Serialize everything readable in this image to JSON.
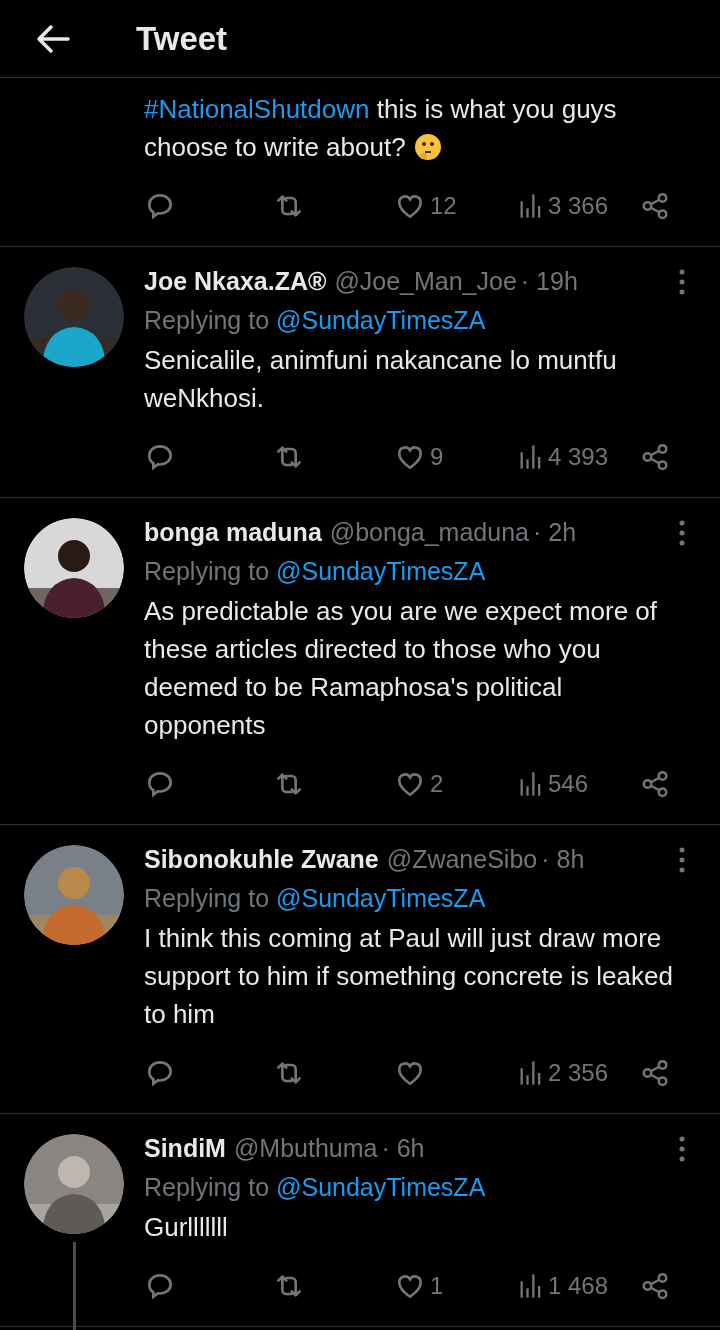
{
  "header": {
    "title": "Tweet"
  },
  "tweets": [
    {
      "body": [
        {
          "kind": "hashtag",
          "text": "#NationalShutdown"
        },
        {
          "kind": "text",
          "text": " this is what you guys choose to write about?"
        },
        {
          "kind": "emoji"
        }
      ],
      "likes": "12",
      "views": "3 366"
    },
    {
      "name": "Joe Nkaxa.ZA®",
      "handle": "@Joe_Man_Joe",
      "time": "· 19h",
      "replying_label": "Replying to",
      "replying_to": "@SundayTimesZA",
      "body": [
        {
          "kind": "text",
          "text": "Senicalile, animfuni nakancane lo muntfu weNkhosi."
        }
      ],
      "likes": "9",
      "views": "4 393"
    },
    {
      "name": "bonga maduna",
      "handle": "@bonga_maduna",
      "time": "· 2h",
      "replying_label": "Replying to",
      "replying_to": "@SundayTimesZA",
      "body": [
        {
          "kind": "text",
          "text": "As predictable as you are we expect more of these articles directed to those who you deemed to be Ramaphosa's political opponents"
        }
      ],
      "likes": "2",
      "views": "546"
    },
    {
      "name": "Sibonokuhle Zwane",
      "handle": "@ZwaneSibo",
      "time": "· 8h",
      "replying_label": "Replying to",
      "replying_to": "@SundayTimesZA",
      "body": [
        {
          "kind": "text",
          "text": "I think this coming at Paul will just draw more support to him if something concrete is leaked to him"
        }
      ],
      "views": "2 356"
    },
    {
      "name": "SindiM",
      "handle": "@Mbuthuma",
      "time": "· 6h",
      "replying_label": "Replying to",
      "replying_to": "@SundayTimesZA",
      "body": [
        {
          "kind": "text",
          "text": "Gurlllllll"
        }
      ],
      "likes": "1",
      "views": "1 468",
      "thread_line": true
    }
  ]
}
